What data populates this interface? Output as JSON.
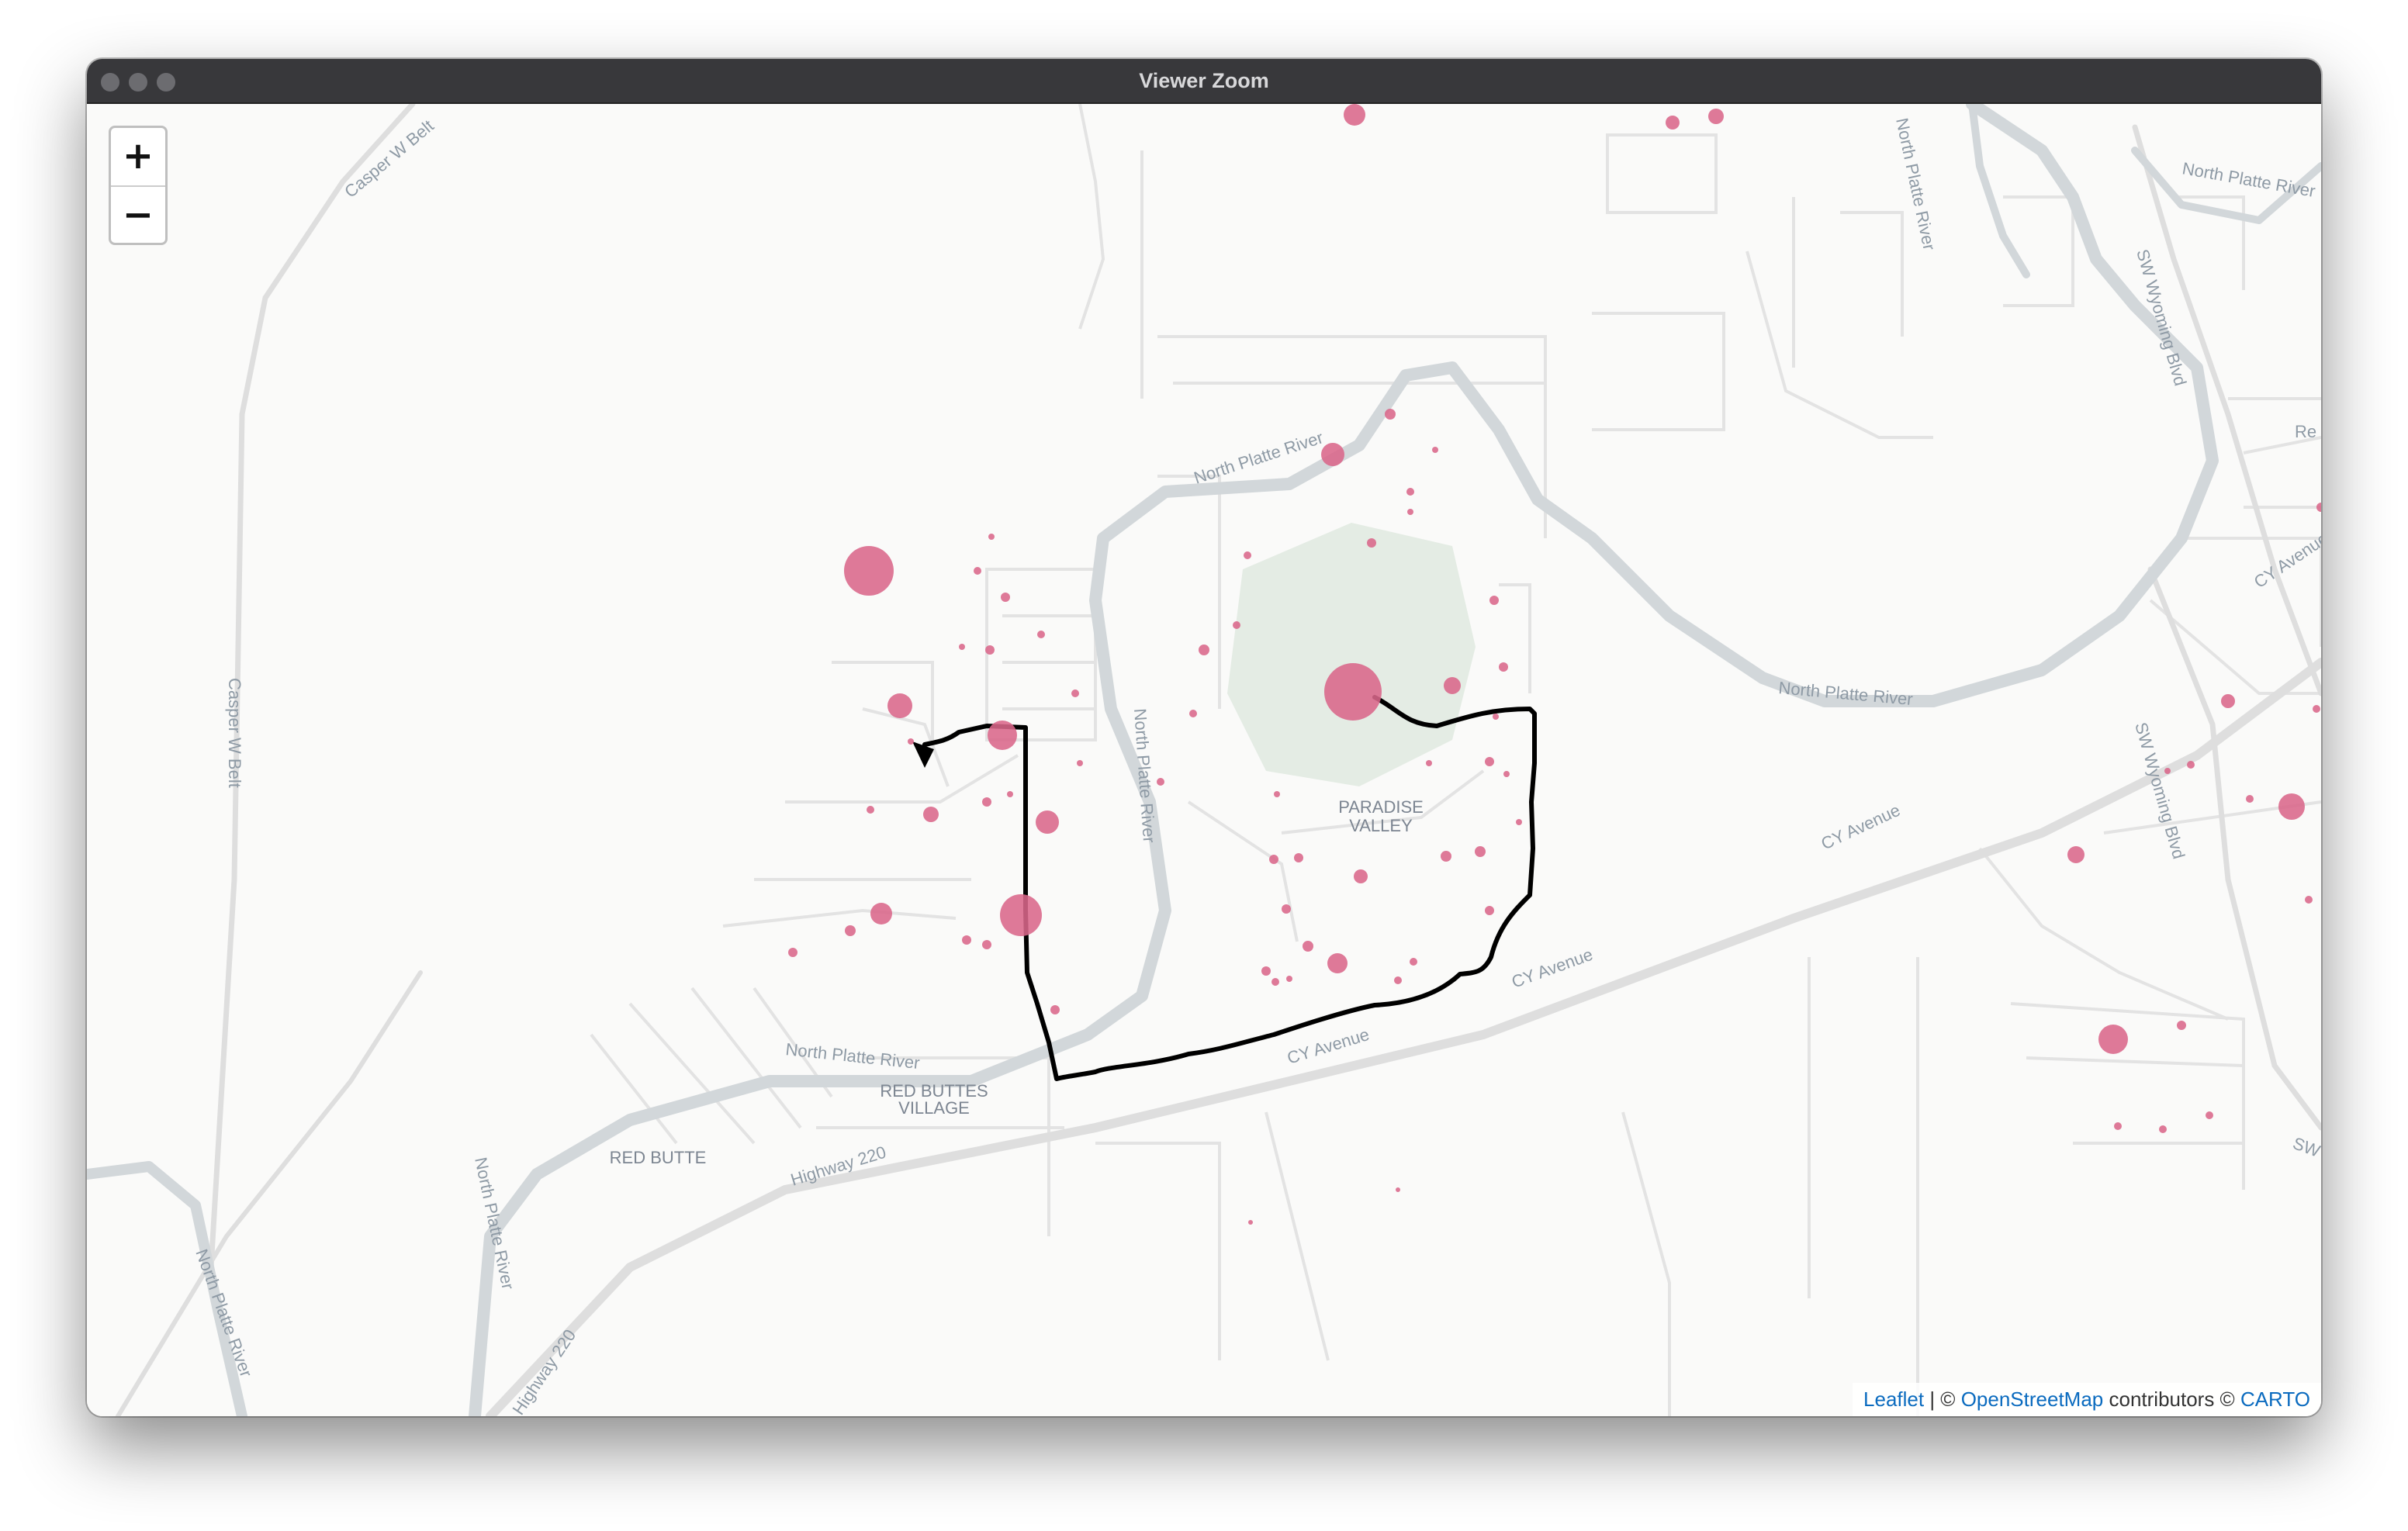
{
  "window": {
    "title": "Viewer Zoom"
  },
  "zoom_controls": {
    "zoom_in": "+",
    "zoom_out": "−"
  },
  "attribution": {
    "leaflet": "Leaflet",
    "sep": " | © ",
    "osm": "OpenStreetMap",
    "contributors": " contributors © ",
    "carto": "CARTO"
  },
  "map_labels": {
    "north_platte_river": "North Platte River",
    "casper_w_belt": "Casper W Belt",
    "sw_wyoming_blvd": "SW Wyoming Blvd",
    "cy_avenue": "CY Avenue",
    "highway_220": "Highway 220",
    "paradise_valley_1": "PARADISE",
    "paradise_valley_2": "VALLEY",
    "red_buttes_village_1": "RED BUTTES",
    "red_buttes_village_2": "VILLAGE",
    "red_butte": "RED BUTTE",
    "partial_re": "Re",
    "partial_sw": "SW"
  },
  "colors": {
    "marker": "#d9668a",
    "route": "#000000",
    "river": "#d4d8db",
    "road": "#e2e2e2",
    "park": "#e3ebe3"
  }
}
